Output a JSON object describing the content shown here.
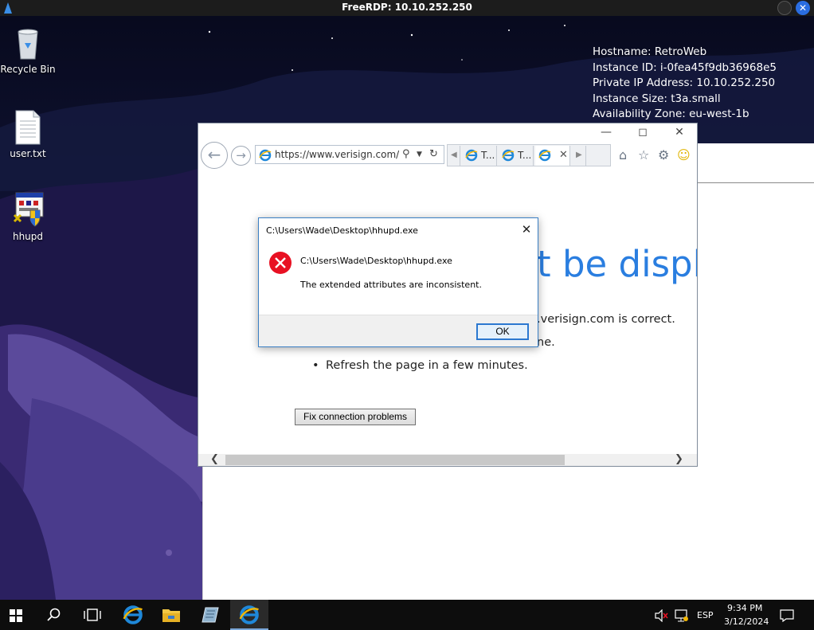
{
  "rdp": {
    "title": "FreeRDP: 10.10.252.250",
    "close_glyph": "✕"
  },
  "desktop": {
    "icons": [
      {
        "label": "Recycle Bin"
      },
      {
        "label": "user.txt"
      },
      {
        "label": "hhupd"
      }
    ],
    "bginfo": [
      "Hostname: RetroWeb",
      "Instance ID: i-0fea45f9db36968e5",
      "Private IP Address: 10.10.252.250",
      "Instance Size: t3a.small",
      "Availability Zone: eu-west-1b"
    ]
  },
  "ie": {
    "address": "https://www.verisign.com/rep",
    "tabs": [
      {
        "label": "T..."
      },
      {
        "label": "T..."
      },
      {
        "label": ""
      }
    ],
    "content": {
      "heading": "t be displa",
      "line1": ".verisign.com is correct.",
      "line2": "ne.",
      "bullet": "•",
      "line3": "Refresh the page in a few minutes.",
      "fix_button": "Fix connection problems"
    }
  },
  "dialog": {
    "title": "C:\\Users\\Wade\\Desktop\\hhupd.exe",
    "path": "C:\\Users\\Wade\\Desktop\\hhupd.exe",
    "message": "The extended attributes are inconsistent.",
    "ok_label": "OK",
    "close_glyph": "✕"
  },
  "taskbar": {
    "language": "ESP",
    "time": "9:34 PM",
    "date": "3/12/2024"
  },
  "colors": {
    "accent": "#2a7ee0",
    "error_red": "#e81123",
    "ie_blue": "#1f88d9"
  }
}
